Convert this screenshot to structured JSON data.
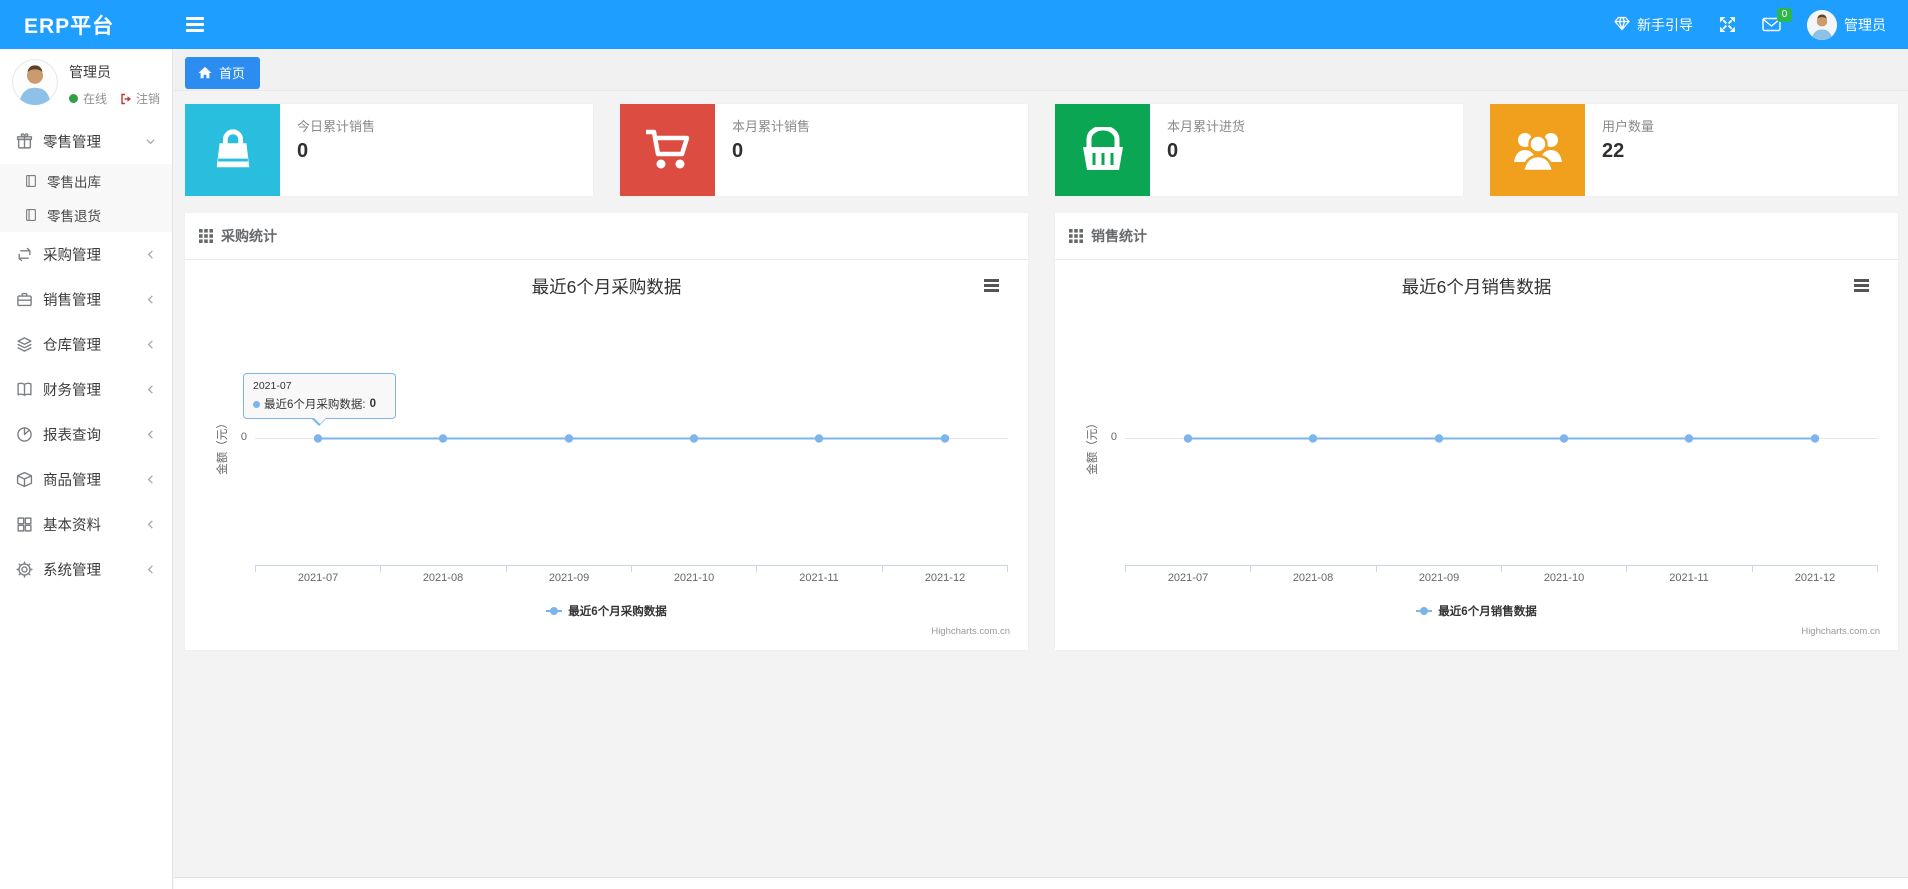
{
  "navbar": {
    "brand": "ERP平台",
    "guide_label": "新手引导",
    "mail_badge": "0",
    "username": "管理员"
  },
  "sidebar": {
    "user": {
      "name": "管理员",
      "status_label": "在线",
      "logout_label": "注销"
    },
    "items": [
      {
        "label": "零售管理",
        "icon": "gift-icon",
        "state": "expanded",
        "children": [
          {
            "label": "零售出库"
          },
          {
            "label": "零售退货"
          }
        ]
      },
      {
        "label": "采购管理",
        "icon": "repeat-icon",
        "state": "collapsed"
      },
      {
        "label": "销售管理",
        "icon": "briefcase-icon",
        "state": "collapsed"
      },
      {
        "label": "仓库管理",
        "icon": "layers-icon",
        "state": "collapsed"
      },
      {
        "label": "财务管理",
        "icon": "open-book-icon",
        "state": "collapsed"
      },
      {
        "label": "报表查询",
        "icon": "pie-chart-icon",
        "state": "collapsed"
      },
      {
        "label": "商品管理",
        "icon": "package-icon",
        "state": "collapsed"
      },
      {
        "label": "基本资料",
        "icon": "grid-icon",
        "state": "collapsed"
      },
      {
        "label": "系统管理",
        "icon": "gear-icon",
        "state": "collapsed"
      }
    ]
  },
  "tabbar": {
    "home_label": "首页"
  },
  "stats": [
    {
      "label": "今日累计销售",
      "value": "0",
      "color": "#29bdde",
      "icon": "shopping-bag-icon"
    },
    {
      "label": "本月累计销售",
      "value": "0",
      "color": "#dc4c41",
      "icon": "shopping-cart-icon"
    },
    {
      "label": "本月累计进货",
      "value": "0",
      "color": "#0ba654",
      "icon": "basket-icon"
    },
    {
      "label": "用户数量",
      "value": "22",
      "color": "#f0a01c",
      "icon": "users-icon"
    }
  ],
  "panels": [
    {
      "title": "采购统计"
    },
    {
      "title": "销售统计"
    }
  ],
  "chart_data": [
    {
      "type": "line",
      "title": "最近6个月采购数据",
      "categories": [
        "2021-07",
        "2021-08",
        "2021-09",
        "2021-10",
        "2021-11",
        "2021-12"
      ],
      "series": [
        {
          "name": "最近6个月采购数据",
          "values": [
            0,
            0,
            0,
            0,
            0,
            0
          ]
        }
      ],
      "xlabel": "",
      "ylabel": "金额（元）",
      "yticks": [
        "0"
      ],
      "grid": true,
      "legend_position": "bottom",
      "series_color": "#7cb5ec",
      "credits": "Highcharts.com.cn",
      "tooltip": {
        "category": "2021-07",
        "series_name": "最近6个月采购数据:",
        "value": "0"
      }
    },
    {
      "type": "line",
      "title": "最近6个月销售数据",
      "categories": [
        "2021-07",
        "2021-08",
        "2021-09",
        "2021-10",
        "2021-11",
        "2021-12"
      ],
      "series": [
        {
          "name": "最近6个月销售数据",
          "values": [
            0,
            0,
            0,
            0,
            0,
            0
          ]
        }
      ],
      "xlabel": "",
      "ylabel": "金额（元）",
      "yticks": [
        "0"
      ],
      "grid": true,
      "legend_position": "bottom",
      "series_color": "#7cb5ec",
      "credits": "Highcharts.com.cn"
    }
  ]
}
